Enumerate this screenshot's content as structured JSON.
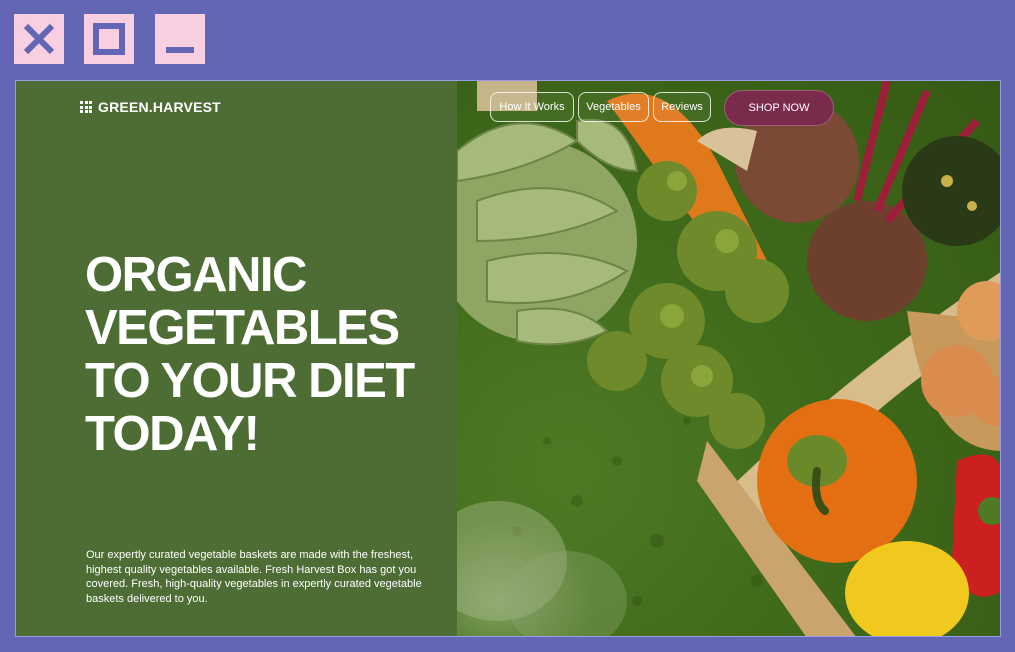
{
  "window_controls": {
    "close_icon": "close-icon",
    "maximize_icon": "maximize-icon",
    "minimize_icon": "minimize-icon"
  },
  "colors": {
    "background": "#6366b4",
    "panel_green": "#4d6d35",
    "button_pink": "#f7cfe0",
    "shop_button": "#7a2a4a"
  },
  "brand": {
    "logo_text": "GREEN.HARVEST",
    "logo_icon": "grid-icon"
  },
  "nav": {
    "items": [
      {
        "label": "How It Works"
      },
      {
        "label": "Vegetables"
      },
      {
        "label": "Reviews"
      }
    ],
    "cta_label": "SHOP NOW"
  },
  "hero": {
    "headline_lines": [
      "ORGANIC",
      "VEGETABLES",
      "TO YOUR DIET",
      "TODAY!"
    ],
    "body": "Our expertly curated vegetable baskets are made with the freshest, highest quality vegetables available. Fresh Harvest Box has got you covered. Fresh, high-quality vegetables in expertly curated vegetable baskets delivered to you.",
    "image_subject": "vegetable-basket-photo"
  }
}
